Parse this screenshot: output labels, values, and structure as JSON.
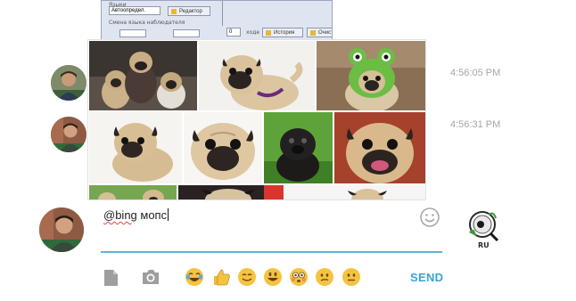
{
  "messages": [
    {
      "timestamp": "4:56:05 PM"
    },
    {
      "timestamp": "4:56:31 PM"
    }
  ],
  "screenshot_thumb": {
    "fields": [
      "Языки",
      "Автоопредел."
    ],
    "buttons": [
      "Редактор",
      "История",
      "Очистить"
    ],
    "checkbox_label": "Смена языка наблюдателя",
    "value_field": "0",
    "side_label": "ходе"
  },
  "image_results": {
    "subject": "pug",
    "count": 11
  },
  "composer": {
    "command": "@bing",
    "query": " мопс",
    "send_label": "SEND"
  },
  "toolbar": {
    "icons": [
      "file-icon",
      "camera-icon"
    ],
    "emojis": [
      "laughing-emoji",
      "thumbs-up-emoji",
      "smile-emoji",
      "grin-emoji",
      "flushed-emoji",
      "confused-emoji",
      "neutral-emoji"
    ]
  },
  "logo": {
    "text": "RU"
  },
  "colors": {
    "accent": "#3aa3da",
    "input_underline": "#5fb3dd",
    "timestamp": "#a6a6a6",
    "emoji_yellow": "#f5c342"
  }
}
